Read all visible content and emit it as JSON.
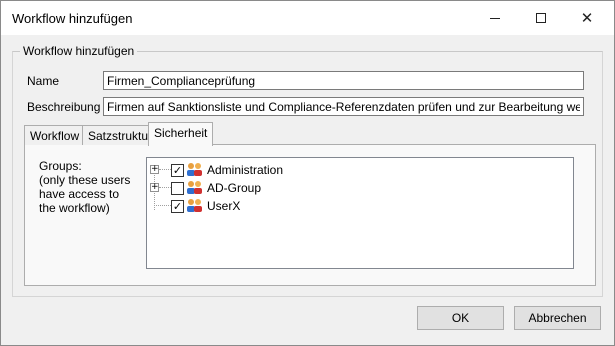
{
  "window": {
    "title": "Workflow hinzufügen",
    "controls": {
      "minimize": "minimize-icon",
      "maximize": "maximize-icon",
      "close": "close-icon"
    }
  },
  "group": {
    "legend": "Workflow hinzufügen"
  },
  "form": {
    "name_label": "Name",
    "name_value": "Firmen_Complianceprüfung",
    "description_label": "Beschreibung",
    "description_value": "Firmen auf Sanktionsliste und Compliance-Referenzdaten prüfen und zur Bearbeitung weiterleiten"
  },
  "tabs": [
    {
      "label": "Workflow",
      "active": false
    },
    {
      "label": "Satzstruktur",
      "active": false
    },
    {
      "label": "Sicherheit",
      "active": true
    }
  ],
  "security": {
    "groups_label_lines": [
      "Groups:",
      "(only these users",
      "have access to",
      "the workflow)"
    ],
    "tree": [
      {
        "label": "Administration",
        "checked": true,
        "expandable": true
      },
      {
        "label": "AD-Group",
        "checked": false,
        "expandable": true
      },
      {
        "label": "UserX",
        "checked": true,
        "expandable": false
      }
    ]
  },
  "buttons": {
    "ok": "OK",
    "cancel": "Abbrechen"
  },
  "colors": {
    "window_bg": "#f0f0f0",
    "titlebar_bg": "#ffffff",
    "button_bg": "#e1e1e1"
  }
}
